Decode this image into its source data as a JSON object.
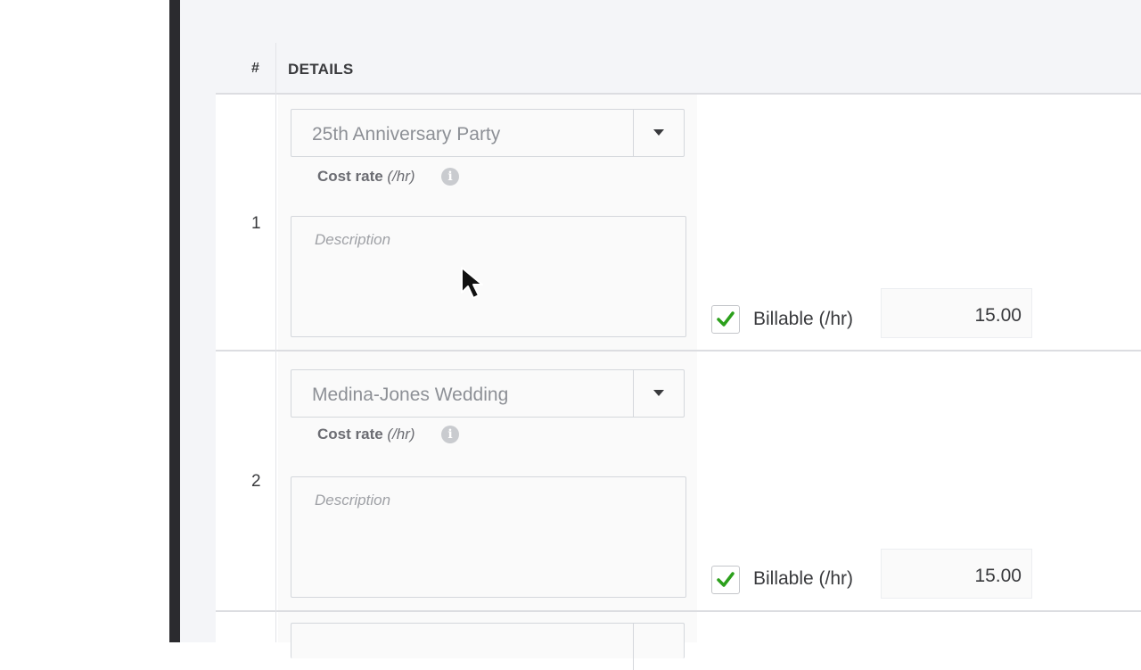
{
  "table": {
    "header": {
      "num_label": "#",
      "details_label": "DETAILS"
    },
    "rows": [
      {
        "number": "1",
        "project": "25th Anniversary Party",
        "cost_rate_label": "Cost rate",
        "cost_rate_unit": "(/hr)",
        "description_placeholder": "Description",
        "billable_label": "Billable (/hr)",
        "billable_checked": true,
        "rate": "15.00"
      },
      {
        "number": "2",
        "project": "Medina-Jones Wedding",
        "cost_rate_label": "Cost rate",
        "cost_rate_unit": "(/hr)",
        "description_placeholder": "Description",
        "billable_label": "Billable (/hr)",
        "billable_checked": true,
        "rate": "15.00"
      }
    ]
  },
  "icons": {
    "info": "info-icon",
    "dropdown": "chevron-down-icon",
    "check": "checkmark-icon",
    "cursor": "mouse-pointer-icon"
  },
  "colors": {
    "check_green": "#2ca01c",
    "sidebar_dark": "#2b2b2f",
    "header_bg": "#f4f5f8"
  }
}
